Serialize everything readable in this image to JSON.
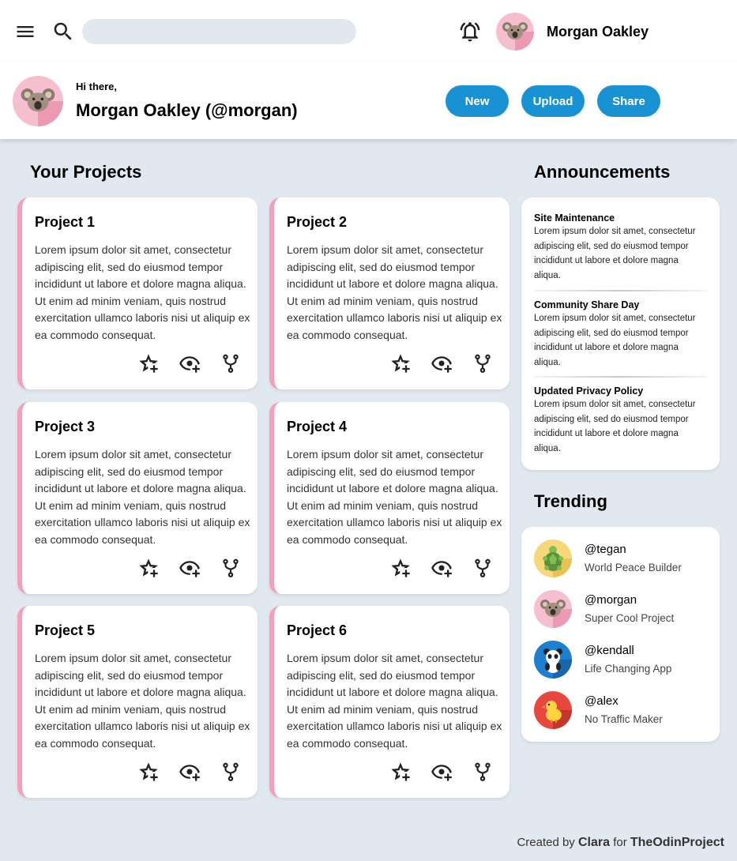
{
  "topbar": {
    "search": {
      "value": "",
      "placeholder": ""
    },
    "user_name": "Morgan Oakley"
  },
  "header": {
    "greeting": "Hi there,",
    "name": "Morgan Oakley (@morgan)",
    "buttons": {
      "new": "New",
      "upload": "Upload",
      "share": "Share"
    }
  },
  "projects": {
    "title": "Your Projects",
    "items": [
      {
        "title": "Project 1",
        "text": "Lorem ipsum dolor sit amet, consectetur adipiscing elit, sed do eiusmod tempor incididunt ut labore et dolore magna aliqua. Ut enim ad minim veniam, quis nostrud exercitation ullamco laboris nisi ut aliquip ex ea commodo consequat."
      },
      {
        "title": "Project 2",
        "text": "Lorem ipsum dolor sit amet, consectetur adipiscing elit, sed do eiusmod tempor incididunt ut labore et dolore magna aliqua. Ut enim ad minim veniam, quis nostrud exercitation ullamco laboris nisi ut aliquip ex ea commodo consequat."
      },
      {
        "title": "Project 3",
        "text": "Lorem ipsum dolor sit amet, consectetur adipiscing elit, sed do eiusmod tempor incididunt ut labore et dolore magna aliqua. Ut enim ad minim veniam, quis nostrud exercitation ullamco laboris nisi ut aliquip ex ea commodo consequat."
      },
      {
        "title": "Project 4",
        "text": "Lorem ipsum dolor sit amet, consectetur adipiscing elit, sed do eiusmod tempor incididunt ut labore et dolore magna aliqua. Ut enim ad minim veniam, quis nostrud exercitation ullamco laboris nisi ut aliquip ex ea commodo consequat."
      },
      {
        "title": "Project 5",
        "text": "Lorem ipsum dolor sit amet, consectetur adipiscing elit, sed do eiusmod tempor incididunt ut labore et dolore magna aliqua. Ut enim ad minim veniam, quis nostrud exercitation ullamco laboris nisi ut aliquip ex ea commodo consequat."
      },
      {
        "title": "Project 6",
        "text": "Lorem ipsum dolor sit amet, consectetur adipiscing elit, sed do eiusmod tempor incididunt ut labore et dolore magna aliqua. Ut enim ad minim veniam, quis nostrud exercitation ullamco laboris nisi ut aliquip ex ea commodo consequat."
      }
    ]
  },
  "announcements": {
    "title": "Announcements",
    "items": [
      {
        "title": "Site Maintenance",
        "text": "Lorem ipsum dolor sit amet, consectetur adipiscing elit, sed do eiusmod tempor incididunt ut labore et dolore magna aliqua."
      },
      {
        "title": "Community Share Day",
        "text": "Lorem ipsum dolor sit amet, consectetur adipiscing elit, sed do eiusmod tempor incididunt ut labore et dolore magna aliqua."
      },
      {
        "title": "Updated Privacy Policy",
        "text": "Lorem ipsum dolor sit amet, consectetur adipiscing elit, sed do eiusmod tempor incididunt ut labore et dolore magna aliqua."
      }
    ]
  },
  "trending": {
    "title": "Trending",
    "items": [
      {
        "handle": "@tegan",
        "desc": "World Peace Builder",
        "avatar": "turtle"
      },
      {
        "handle": "@morgan",
        "desc": "Super Cool Project",
        "avatar": "koala"
      },
      {
        "handle": "@kendall",
        "desc": "Life Changing App",
        "avatar": "panda"
      },
      {
        "handle": "@alex",
        "desc": "No Traffic Maker",
        "avatar": "chick"
      }
    ]
  },
  "footer": {
    "prefix": "Created by",
    "author": "Clara",
    "for": "for",
    "project": "TheOdinProject"
  },
  "colors": {
    "accent": "#1992d4",
    "card_border": "#f4a0b8",
    "background": "#e2e8f0"
  }
}
